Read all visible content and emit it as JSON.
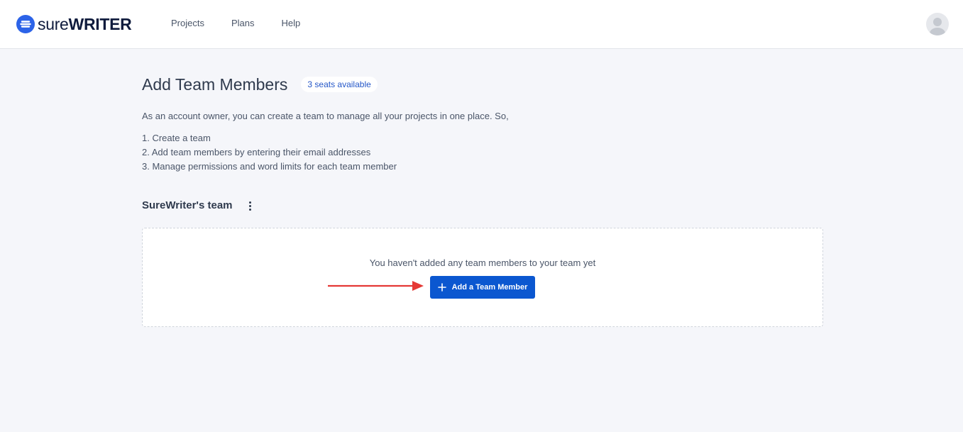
{
  "header": {
    "logo": {
      "prefix": "sure",
      "suffix": "WRITER",
      "icon": "surewriter-logo-icon"
    },
    "nav": [
      {
        "label": "Projects"
      },
      {
        "label": "Plans"
      },
      {
        "label": "Help"
      }
    ],
    "avatar_icon": "user-avatar-icon"
  },
  "page": {
    "title": "Add Team Members",
    "seats_badge": "3 seats available",
    "intro": "As an account owner, you can create a team to manage all your projects in one place. So,",
    "steps": [
      "1. Create a team",
      "2. Add team members by entering their email addresses",
      "3. Manage permissions and word limits for each team member"
    ]
  },
  "team": {
    "name": "SureWriter's team",
    "menu_icon": "kebab-menu-icon",
    "empty_message": "You haven't added any team members to your team yet",
    "add_button": {
      "label": "Add a Team Member",
      "icon": "plus-icon"
    }
  },
  "colors": {
    "accent": "#0b57d0",
    "background": "#f5f6fa",
    "annotation_arrow": "#e53935"
  }
}
